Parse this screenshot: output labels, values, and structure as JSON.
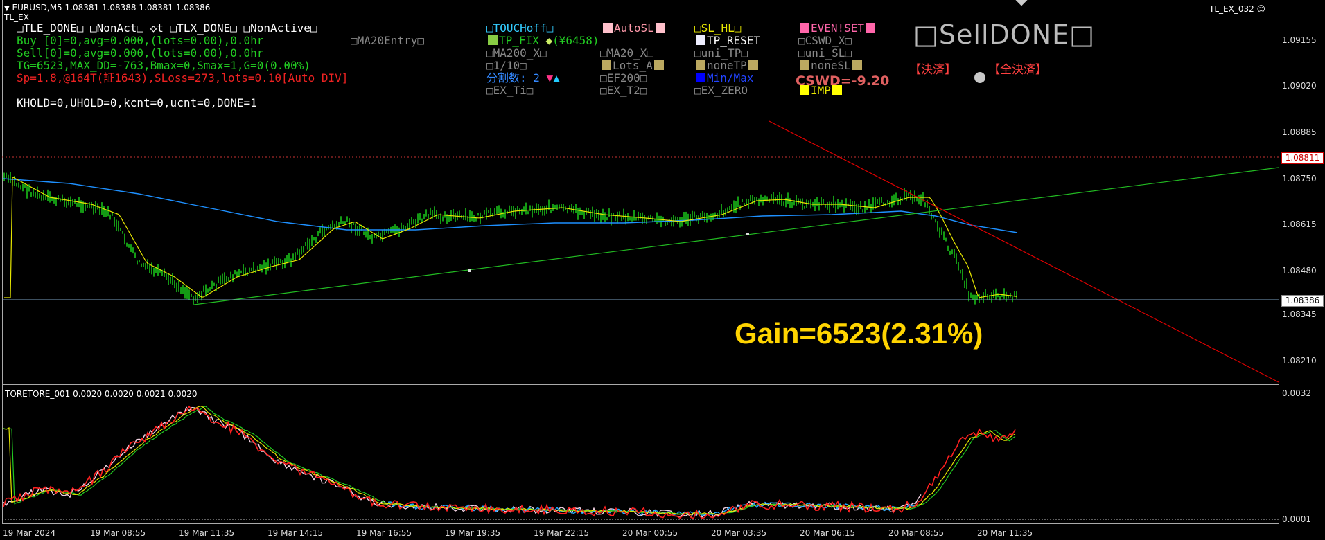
{
  "header": {
    "symbol_line": "EURUSD,M5  1.08381 1.08388 1.08381 1.08386",
    "sub_title": "TL_EX",
    "ea_name": "TL_EX_032 ☺"
  },
  "left_panel": {
    "row1": "□TLE_DONE□  □NonAct□ ◇t  □TLX_DONE□  □NonActive□",
    "row2": "Buy [0]=0,avg=0.000,(lots=0.00),0.0hr",
    "row2b": "□MA20Entry□",
    "row3": "Sell[0]=0,avg=0.000,(lots=0.00),0.0hr",
    "row4": "TG=6523,MAX_DD=-763,Bmax=0,Smax=1,G=0(0.00%)",
    "row5": "Sp=1.8,@164T(証1643),SLoss=273,lots=0.10[Auto_DIV]",
    "row6": "KHOLD=0,UHOLD=0,kcnt=0,ucnt=0,DONE=1"
  },
  "buttons": {
    "touchoff": "□TOUCHoff□",
    "autosl": "AutoSL",
    "sl_hl": "□SL_HL□",
    "evenset": "EVEN!SET",
    "tp_fix": "TP_FIX",
    "tp_fix_yen": "(¥6458)",
    "tp_reset": "TP_RESET",
    "cswd_x": "□CSWD_X□",
    "ma200_x": "□MA200_X□",
    "ma20_x": "□MA20_X□",
    "uni_tp": "□uni_TP□",
    "uni_sl": "□uni_SL□",
    "one_tenth": "□1/10□",
    "lots_a": "Lots_A",
    "nonetp": "noneTP",
    "nonesl": "noneSL",
    "bunkatsu": "分割数: 2",
    "ef200": "□EF200□",
    "minmax": "Min/Max",
    "cswd_val": "CSWD=-9.20",
    "ex_ti": "□EX_Ti□",
    "ex_t2": "□EX_T2□",
    "ex_zero": "□EX_ZERO",
    "imp": "IMP",
    "sell_done": "□SellDONE□",
    "kessai": "【決済】",
    "zen_kessai": "【全決済】"
  },
  "gain_text": "Gain=6523(2.31%)",
  "price_axis": {
    "ticks": [
      "1.09155",
      "1.09020",
      "1.08885",
      "1.08750",
      "1.08615",
      "1.08480",
      "1.08345",
      "1.08210"
    ],
    "tag_red": "1.08811",
    "tag_current": "1.08386"
  },
  "indicator": {
    "title": "TORETORE_001 0.0020 0.0020 0.0021 0.0020",
    "top_value": "0.0032",
    "bottom_value": "0.0001"
  },
  "time_axis": [
    "19 Mar 2024",
    "19 Mar 08:55",
    "19 Mar 11:35",
    "19 Mar 14:15",
    "19 Mar 16:55",
    "19 Mar 19:35",
    "19 Mar 22:15",
    "20 Mar 00:55",
    "20 Mar 03:35",
    "20 Mar 06:15",
    "20 Mar 08:55",
    "20 Mar 11:35"
  ],
  "colors": {
    "candle": "#22ff22",
    "ma_fast": "#e6e600",
    "ma_slow": "#1e90ff",
    "trend_green": "#22bb22",
    "trend_red": "#e00000",
    "indicator_red": "#ff2020",
    "gain": "#ffd400"
  }
}
